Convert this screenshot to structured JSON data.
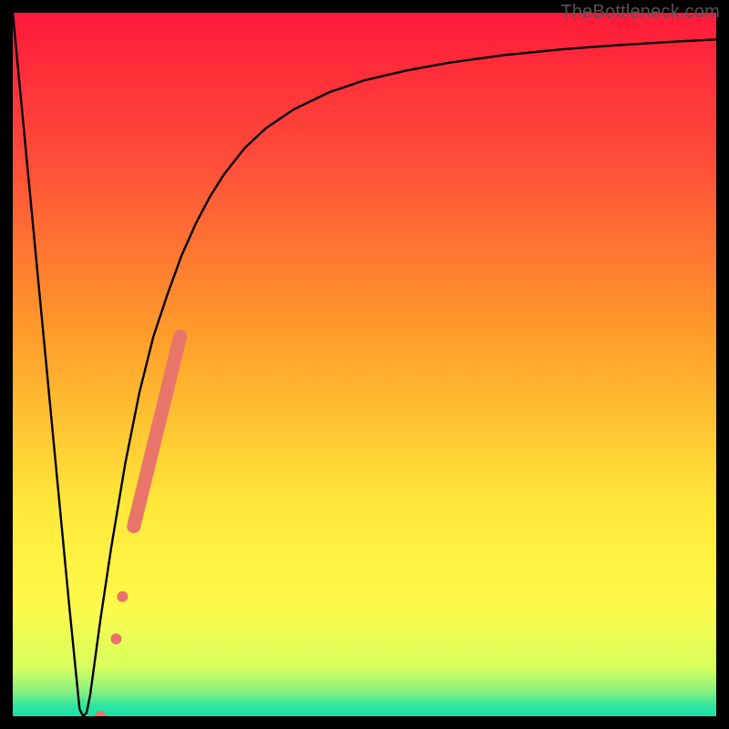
{
  "watermark": "TheBottleneck.com",
  "chart_data": {
    "type": "line",
    "title": "",
    "xlabel": "",
    "ylabel": "",
    "xlim": [
      0,
      100
    ],
    "ylim": [
      0,
      100
    ],
    "background": {
      "type": "vertical-gradient",
      "stops": [
        {
          "offset": 0.0,
          "color": "#ff1a3a"
        },
        {
          "offset": 0.2,
          "color": "#ff4a3a"
        },
        {
          "offset": 0.45,
          "color": "#ff9a2a"
        },
        {
          "offset": 0.7,
          "color": "#ffe83a"
        },
        {
          "offset": 0.84,
          "color": "#fff94a"
        },
        {
          "offset": 0.93,
          "color": "#d8ff5e"
        },
        {
          "offset": 0.965,
          "color": "#88f082"
        },
        {
          "offset": 0.985,
          "color": "#2fe6a0"
        },
        {
          "offset": 1.0,
          "color": "#18e0a8"
        }
      ]
    },
    "series": [
      {
        "name": "bottleneck-curve",
        "stroke": "#000000",
        "x": [
          0.0,
          2,
          4,
          6,
          8,
          9.5,
          10,
          10.5,
          11,
          12.5,
          14,
          16,
          18,
          20,
          22,
          24,
          26,
          28,
          30,
          33,
          36,
          40,
          45,
          50,
          56,
          62,
          70,
          78,
          86,
          94,
          100
        ],
        "values": [
          100,
          79,
          58,
          37,
          16,
          1,
          0,
          0.5,
          3,
          14,
          24,
          36,
          46,
          54,
          60,
          65.5,
          70,
          73.8,
          77,
          80.8,
          83.6,
          86.3,
          88.7,
          90.4,
          91.8,
          92.9,
          94,
          94.8,
          95.4,
          95.9,
          96.2
        ]
      }
    ],
    "markers": {
      "name": "highlight-dots",
      "fill": "#e9746a",
      "points": [
        {
          "x": 12.5,
          "y": 0,
          "r": 6
        },
        {
          "x": 14.7,
          "y": 11,
          "r": 6
        },
        {
          "x": 15.6,
          "y": 17,
          "r": 6
        }
      ],
      "thick_segment": {
        "x0": 17.2,
        "y0": 27,
        "x1": 23.8,
        "y1": 54,
        "width": 15
      }
    }
  }
}
